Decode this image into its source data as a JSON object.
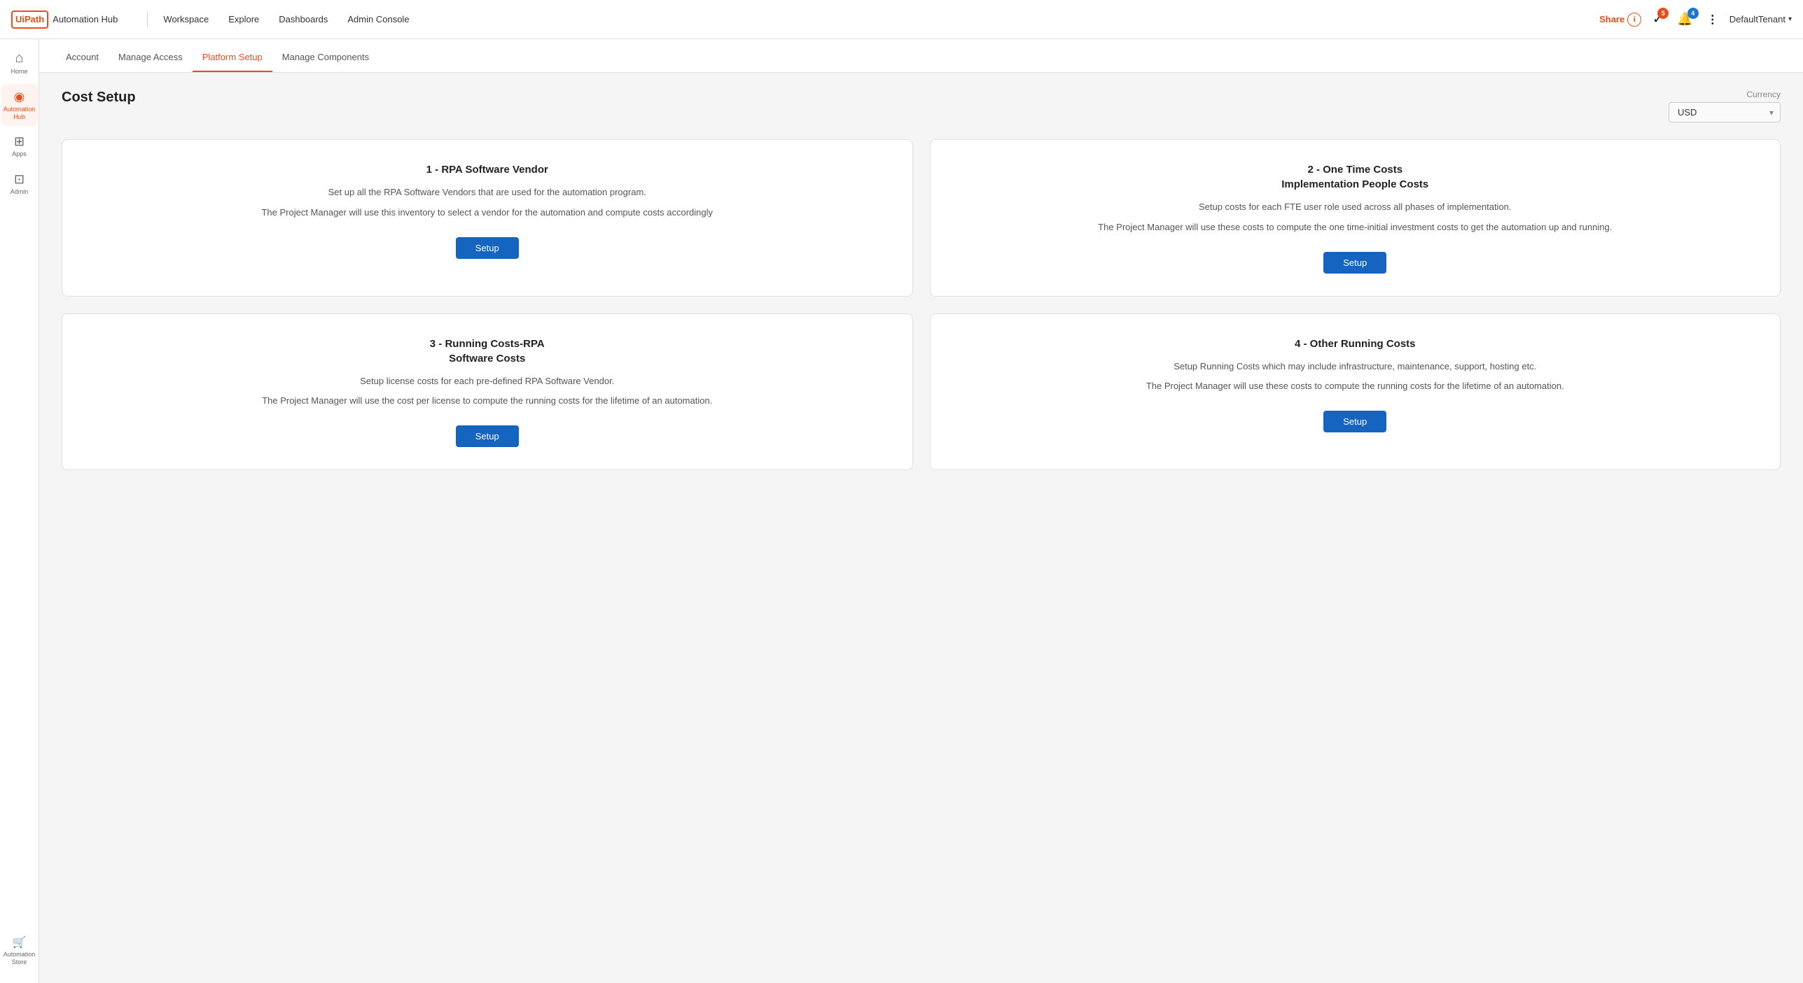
{
  "topnav": {
    "logo_brand": "UiPath",
    "logo_product": "Automation Hub",
    "links": [
      {
        "label": "Workspace",
        "id": "workspace"
      },
      {
        "label": "Explore",
        "id": "explore"
      },
      {
        "label": "Dashboards",
        "id": "dashboards"
      },
      {
        "label": "Admin Console",
        "id": "admin-console"
      }
    ],
    "share_label": "Share",
    "badge_tasks": "5",
    "badge_notifs": "4",
    "tenant_label": "DefaultTenant"
  },
  "sidebar": {
    "items": [
      {
        "label": "Home",
        "icon": "⌂",
        "id": "home",
        "active": false
      },
      {
        "label": "Automation Hub",
        "icon": "◎",
        "id": "automation-hub",
        "active": true
      },
      {
        "label": "Apps",
        "icon": "⊞",
        "id": "apps",
        "active": false
      },
      {
        "label": "Admin",
        "icon": "⊡",
        "id": "admin",
        "active": false
      }
    ],
    "bottom_items": [
      {
        "label": "Automation Store",
        "icon": "🛒",
        "id": "automation-store"
      }
    ]
  },
  "subnav": {
    "items": [
      {
        "label": "Account",
        "id": "account",
        "active": false
      },
      {
        "label": "Manage Access",
        "id": "manage-access",
        "active": false
      },
      {
        "label": "Platform Setup",
        "id": "platform-setup",
        "active": true
      },
      {
        "label": "Manage Components",
        "id": "manage-components",
        "active": false
      }
    ]
  },
  "page": {
    "title": "Cost Setup",
    "currency_label": "Currency",
    "currency_value": "USD"
  },
  "cards": [
    {
      "id": "rpa-vendor",
      "title": "1 - RPA Software Vendor",
      "desc1": "Set up all the RPA Software Vendors that are used for the automation program.",
      "desc2": "The Project Manager will use this inventory to select a vendor for the automation and compute costs accordingly",
      "btn_label": "Setup"
    },
    {
      "id": "one-time-costs",
      "title": "2 - One Time Costs\nImplementation People Costs",
      "desc1": "Setup costs for each FTE user role used across all phases of implementation.",
      "desc2": "The Project Manager will use these costs to compute the one time-initial investment costs to get the automation up and running.",
      "btn_label": "Setup"
    },
    {
      "id": "running-costs-rpa",
      "title": "3 - Running Costs-RPA\nSoftware Costs",
      "desc1": "Setup license costs for each pre-defined RPA Software Vendor.",
      "desc2": "The Project Manager will use the cost per license to compute the running costs for the lifetime of an automation.",
      "btn_label": "Setup"
    },
    {
      "id": "other-running-costs",
      "title": "4 - Other Running Costs",
      "desc1": "Setup Running Costs which may include infrastructure, maintenance, support, hosting etc.",
      "desc2": "The Project Manager will use these costs to compute the running costs for the lifetime of an automation.",
      "btn_label": "Setup"
    }
  ]
}
